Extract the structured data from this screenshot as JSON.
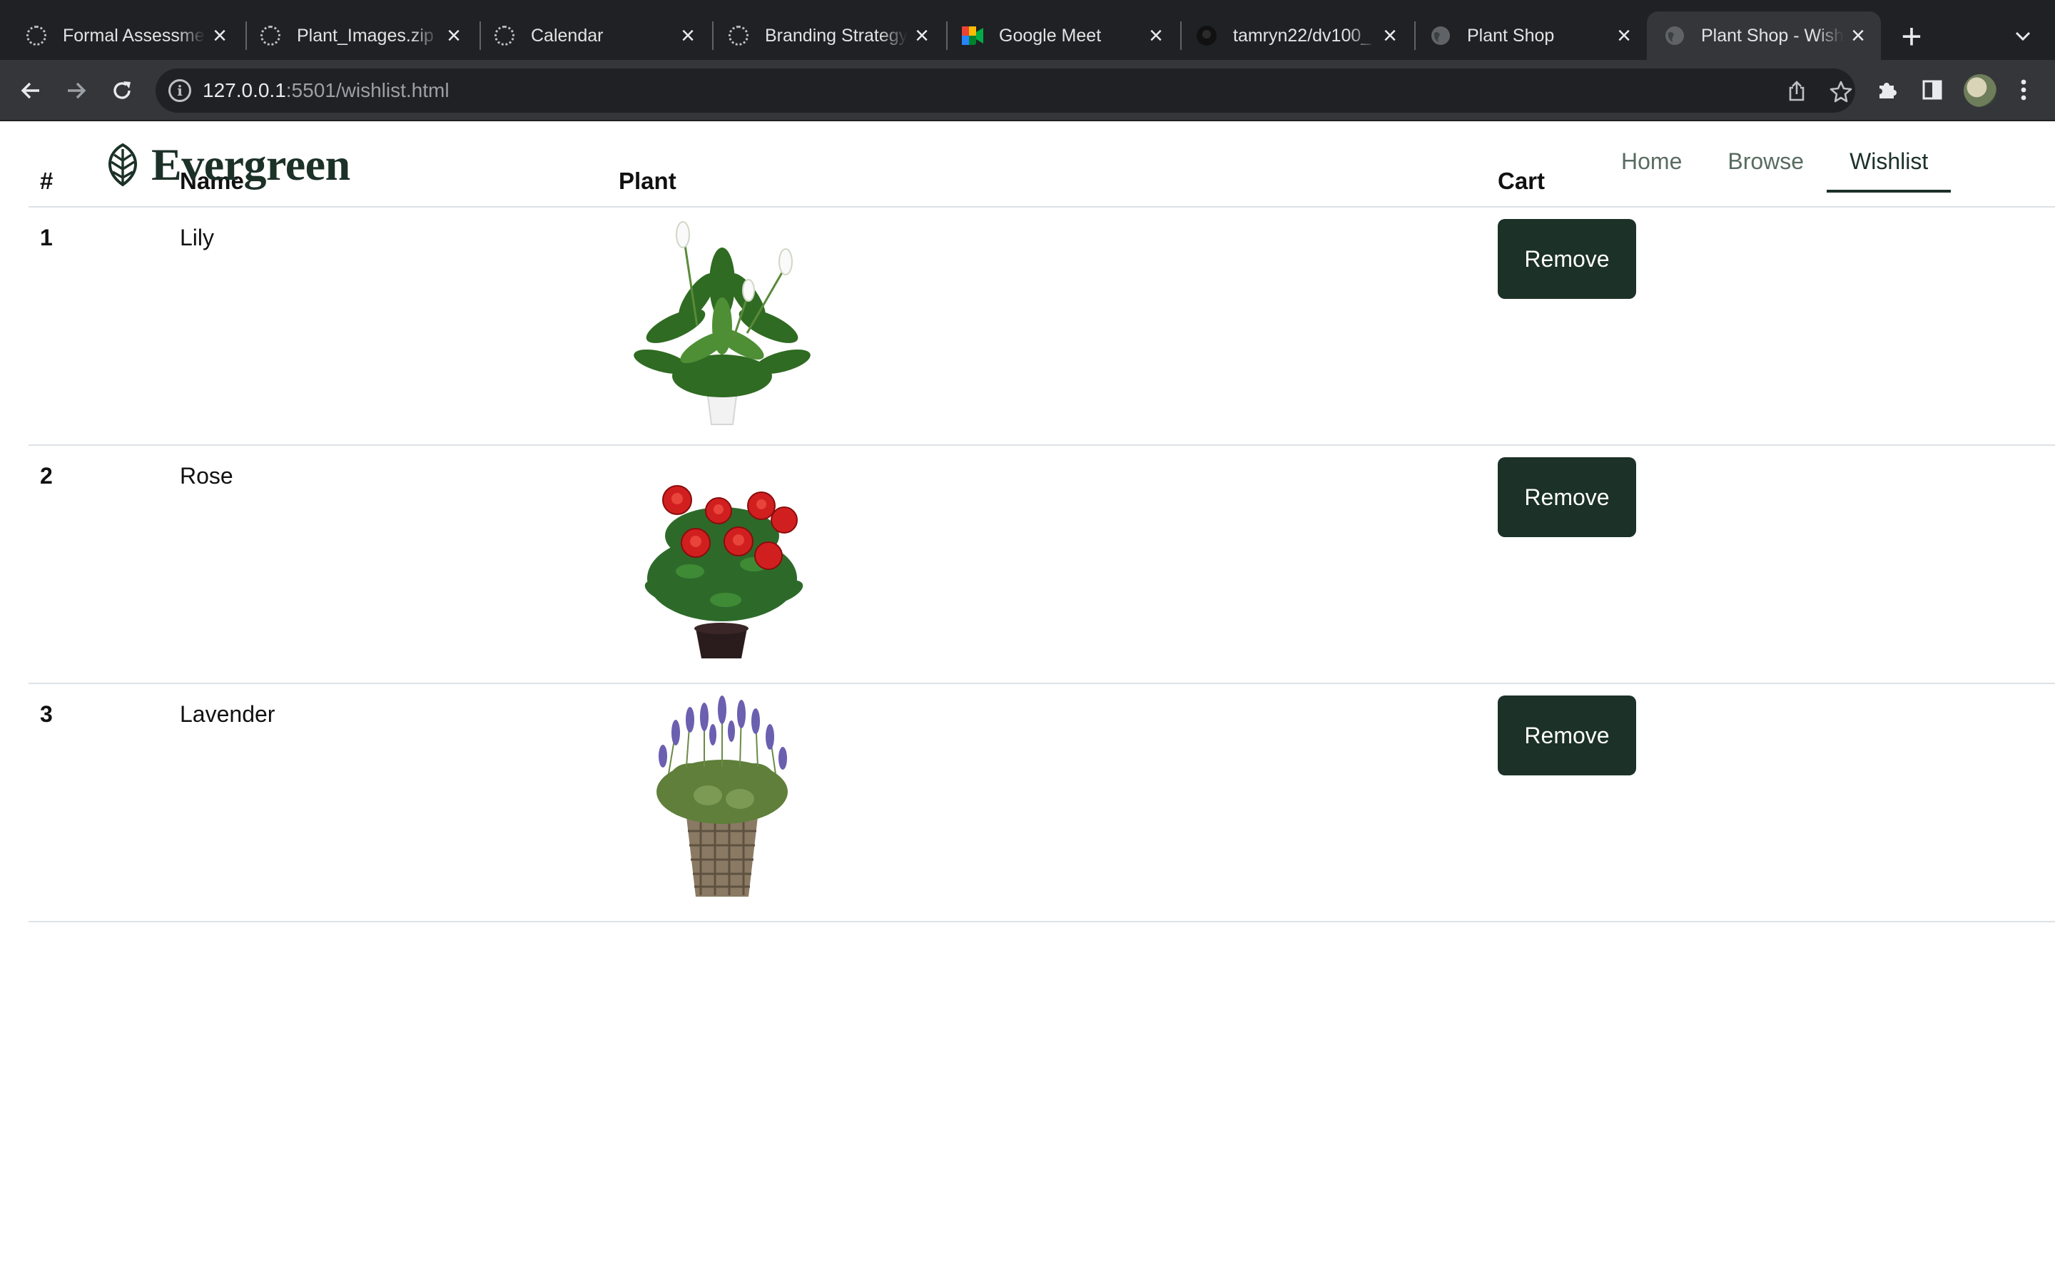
{
  "browser": {
    "tabs": [
      {
        "title": "Formal Assessment",
        "icon": "loading-spinner-icon"
      },
      {
        "title": "Plant_Images.zip",
        "icon": "loading-spinner-icon"
      },
      {
        "title": "Calendar",
        "icon": "loading-spinner-icon"
      },
      {
        "title": "Branding Strategy",
        "icon": "loading-spinner-icon"
      },
      {
        "title": "Google Meet",
        "icon": "google-meet-icon"
      },
      {
        "title": "tamryn22/dv100_",
        "icon": "github-icon"
      },
      {
        "title": "Plant Shop",
        "icon": "globe-icon"
      },
      {
        "title": "Plant Shop - Wishlist",
        "icon": "globe-icon",
        "active": true
      }
    ],
    "address": {
      "host": "127.0.0.1",
      "path": ":5501/wishlist.html"
    }
  },
  "site": {
    "brand": "Evergreen",
    "nav": {
      "home": "Home",
      "browse": "Browse",
      "wishlist": "Wishlist",
      "active": "wishlist"
    },
    "accent_color": "#1c3128"
  },
  "wishlist": {
    "headers": {
      "num": "#",
      "name": "Name",
      "plant": "Plant",
      "cart": "Cart"
    },
    "rows": [
      {
        "num": "1",
        "name": "Lily",
        "image": "peace-lily-plant",
        "action": "Remove"
      },
      {
        "num": "2",
        "name": "Rose",
        "image": "red-rose-plant",
        "action": "Remove"
      },
      {
        "num": "3",
        "name": "Lavender",
        "image": "lavender-plant",
        "action": "Remove"
      }
    ]
  }
}
